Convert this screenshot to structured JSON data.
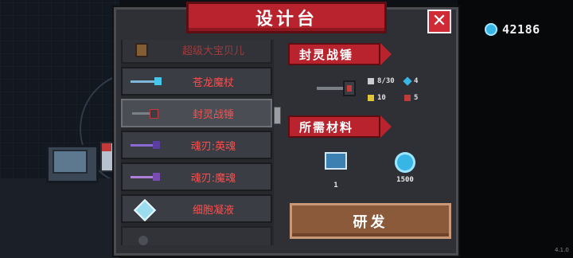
{
  "title": "设计台",
  "currency": {
    "icon": "gem-icon",
    "amount": "42186"
  },
  "version": "4.1.0",
  "list": [
    {
      "label": "超级大宝贝儿",
      "icon": "pet-icon",
      "faded": true
    },
    {
      "label": "苍龙魔杖",
      "icon": "staff-icon"
    },
    {
      "label": "封灵战锤",
      "icon": "hammer-icon",
      "selected": true
    },
    {
      "label": "魂刃:英魂",
      "icon": "sword-purple-icon"
    },
    {
      "label": "魂刃:魔魂",
      "icon": "sword-violet-icon"
    },
    {
      "label": "细胞凝液",
      "icon": "syringe-icon"
    },
    {
      "label": "",
      "icon": "orb-icon",
      "faded": true
    }
  ],
  "detail": {
    "weapon_name": "封灵战锤",
    "stats": {
      "damage": "8/30",
      "energy": "4",
      "crit": "10",
      "accuracy": "5"
    },
    "materials_title": "所需材料",
    "materials": [
      {
        "name": "blueprint",
        "icon": "blueprint-icon",
        "count": "1"
      },
      {
        "name": "gems",
        "icon": "gem-icon",
        "count": "1500"
      }
    ],
    "research_label": "研发"
  },
  "colors": {
    "accent": "#b8232e",
    "text_red": "#ff4d4d",
    "gem": "#37b6e6",
    "button": "#8a5a3b"
  }
}
